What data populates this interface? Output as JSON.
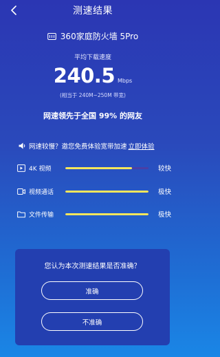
{
  "header": {
    "title": "测速结果"
  },
  "device": {
    "name": "360家庭防火墙 5Pro"
  },
  "speed": {
    "caption": "平均下载速度",
    "value": "240.5",
    "unit": "Mbps",
    "equivalent": "(相当于 240M~250M 带宽)"
  },
  "rank": {
    "text": "网速领先于全国 99% 的网友"
  },
  "promo": {
    "text": "网速较慢？邀您免费体验宽带加速",
    "link": "立即体验"
  },
  "metrics": [
    {
      "label": "4K 视频",
      "grade": "较快",
      "level": 0.8,
      "icon": "video-play-icon"
    },
    {
      "label": "视频通话",
      "grade": "极快",
      "level": 1.0,
      "icon": "video-call-icon"
    },
    {
      "label": "文件传输",
      "grade": "极快",
      "level": 1.0,
      "icon": "folder-icon"
    }
  ],
  "feedback": {
    "question": "您认为本次测速结果是否准确？",
    "accurate_label": "准确",
    "inaccurate_label": "不准确"
  },
  "colors": {
    "bar_fill": "#f6e65c",
    "bar_track": "#4a3fa6",
    "card_bg": "#233fb0"
  }
}
